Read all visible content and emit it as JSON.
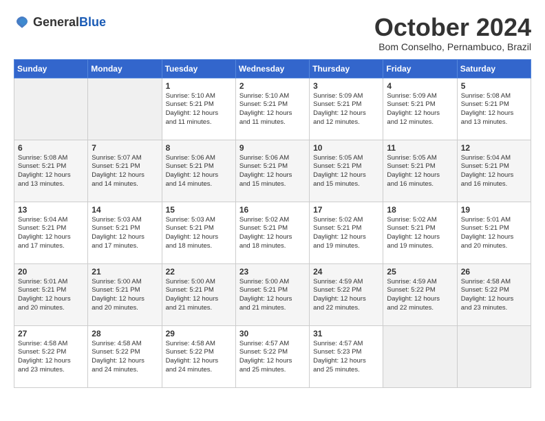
{
  "logo": {
    "general": "General",
    "blue": "Blue"
  },
  "title": {
    "month": "October 2024",
    "location": "Bom Conselho, Pernambuco, Brazil"
  },
  "weekdays": [
    "Sunday",
    "Monday",
    "Tuesday",
    "Wednesday",
    "Thursday",
    "Friday",
    "Saturday"
  ],
  "weeks": [
    [
      {
        "day": "",
        "info": ""
      },
      {
        "day": "",
        "info": ""
      },
      {
        "day": "1",
        "info": "Sunrise: 5:10 AM\nSunset: 5:21 PM\nDaylight: 12 hours\nand 11 minutes."
      },
      {
        "day": "2",
        "info": "Sunrise: 5:10 AM\nSunset: 5:21 PM\nDaylight: 12 hours\nand 11 minutes."
      },
      {
        "day": "3",
        "info": "Sunrise: 5:09 AM\nSunset: 5:21 PM\nDaylight: 12 hours\nand 12 minutes."
      },
      {
        "day": "4",
        "info": "Sunrise: 5:09 AM\nSunset: 5:21 PM\nDaylight: 12 hours\nand 12 minutes."
      },
      {
        "day": "5",
        "info": "Sunrise: 5:08 AM\nSunset: 5:21 PM\nDaylight: 12 hours\nand 13 minutes."
      }
    ],
    [
      {
        "day": "6",
        "info": "Sunrise: 5:08 AM\nSunset: 5:21 PM\nDaylight: 12 hours\nand 13 minutes."
      },
      {
        "day": "7",
        "info": "Sunrise: 5:07 AM\nSunset: 5:21 PM\nDaylight: 12 hours\nand 14 minutes."
      },
      {
        "day": "8",
        "info": "Sunrise: 5:06 AM\nSunset: 5:21 PM\nDaylight: 12 hours\nand 14 minutes."
      },
      {
        "day": "9",
        "info": "Sunrise: 5:06 AM\nSunset: 5:21 PM\nDaylight: 12 hours\nand 15 minutes."
      },
      {
        "day": "10",
        "info": "Sunrise: 5:05 AM\nSunset: 5:21 PM\nDaylight: 12 hours\nand 15 minutes."
      },
      {
        "day": "11",
        "info": "Sunrise: 5:05 AM\nSunset: 5:21 PM\nDaylight: 12 hours\nand 16 minutes."
      },
      {
        "day": "12",
        "info": "Sunrise: 5:04 AM\nSunset: 5:21 PM\nDaylight: 12 hours\nand 16 minutes."
      }
    ],
    [
      {
        "day": "13",
        "info": "Sunrise: 5:04 AM\nSunset: 5:21 PM\nDaylight: 12 hours\nand 17 minutes."
      },
      {
        "day": "14",
        "info": "Sunrise: 5:03 AM\nSunset: 5:21 PM\nDaylight: 12 hours\nand 17 minutes."
      },
      {
        "day": "15",
        "info": "Sunrise: 5:03 AM\nSunset: 5:21 PM\nDaylight: 12 hours\nand 18 minutes."
      },
      {
        "day": "16",
        "info": "Sunrise: 5:02 AM\nSunset: 5:21 PM\nDaylight: 12 hours\nand 18 minutes."
      },
      {
        "day": "17",
        "info": "Sunrise: 5:02 AM\nSunset: 5:21 PM\nDaylight: 12 hours\nand 19 minutes."
      },
      {
        "day": "18",
        "info": "Sunrise: 5:02 AM\nSunset: 5:21 PM\nDaylight: 12 hours\nand 19 minutes."
      },
      {
        "day": "19",
        "info": "Sunrise: 5:01 AM\nSunset: 5:21 PM\nDaylight: 12 hours\nand 20 minutes."
      }
    ],
    [
      {
        "day": "20",
        "info": "Sunrise: 5:01 AM\nSunset: 5:21 PM\nDaylight: 12 hours\nand 20 minutes."
      },
      {
        "day": "21",
        "info": "Sunrise: 5:00 AM\nSunset: 5:21 PM\nDaylight: 12 hours\nand 20 minutes."
      },
      {
        "day": "22",
        "info": "Sunrise: 5:00 AM\nSunset: 5:21 PM\nDaylight: 12 hours\nand 21 minutes."
      },
      {
        "day": "23",
        "info": "Sunrise: 5:00 AM\nSunset: 5:21 PM\nDaylight: 12 hours\nand 21 minutes."
      },
      {
        "day": "24",
        "info": "Sunrise: 4:59 AM\nSunset: 5:22 PM\nDaylight: 12 hours\nand 22 minutes."
      },
      {
        "day": "25",
        "info": "Sunrise: 4:59 AM\nSunset: 5:22 PM\nDaylight: 12 hours\nand 22 minutes."
      },
      {
        "day": "26",
        "info": "Sunrise: 4:58 AM\nSunset: 5:22 PM\nDaylight: 12 hours\nand 23 minutes."
      }
    ],
    [
      {
        "day": "27",
        "info": "Sunrise: 4:58 AM\nSunset: 5:22 PM\nDaylight: 12 hours\nand 23 minutes."
      },
      {
        "day": "28",
        "info": "Sunrise: 4:58 AM\nSunset: 5:22 PM\nDaylight: 12 hours\nand 24 minutes."
      },
      {
        "day": "29",
        "info": "Sunrise: 4:58 AM\nSunset: 5:22 PM\nDaylight: 12 hours\nand 24 minutes."
      },
      {
        "day": "30",
        "info": "Sunrise: 4:57 AM\nSunset: 5:22 PM\nDaylight: 12 hours\nand 25 minutes."
      },
      {
        "day": "31",
        "info": "Sunrise: 4:57 AM\nSunset: 5:23 PM\nDaylight: 12 hours\nand 25 minutes."
      },
      {
        "day": "",
        "info": ""
      },
      {
        "day": "",
        "info": ""
      }
    ]
  ]
}
